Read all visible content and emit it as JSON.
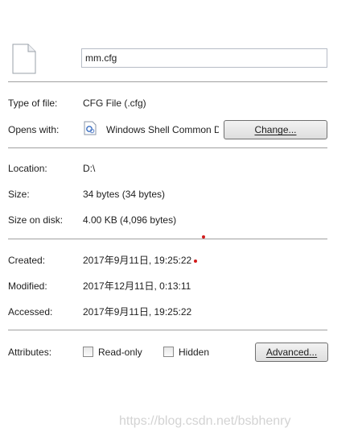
{
  "file": {
    "name": "mm.cfg",
    "icon": "blank-document-icon"
  },
  "type_row": {
    "label": "Type of file:",
    "value": "CFG File (.cfg)"
  },
  "opens_row": {
    "label": "Opens with:",
    "app_icon": "windows-shell-app-icon",
    "value": "Windows Shell Common Dll",
    "change_label": "Change..."
  },
  "location_row": {
    "label": "Location:",
    "value": "D:\\"
  },
  "size_row": {
    "label": "Size:",
    "value": "34 bytes (34 bytes)"
  },
  "size_on_disk_row": {
    "label": "Size on disk:",
    "value": "4.00 KB (4,096 bytes)"
  },
  "created_row": {
    "label": "Created:",
    "value": "2017年9月11日, 19:25:22"
  },
  "modified_row": {
    "label": "Modified:",
    "value": "2017年12月11日, 0:13:11"
  },
  "accessed_row": {
    "label": "Accessed:",
    "value": "2017年9月11日, 19:25:22"
  },
  "attributes": {
    "label": "Attributes:",
    "read_only": {
      "label": "Read-only",
      "checked": false
    },
    "hidden": {
      "label": "Hidden",
      "checked": false
    },
    "advanced_label": "Advanced..."
  },
  "watermark": "https://blog.csdn.net/bsbhenry",
  "colors": {
    "separator": "#a0a0a0",
    "button_border": "#707070",
    "annotation_dot": "#d21a1a"
  }
}
